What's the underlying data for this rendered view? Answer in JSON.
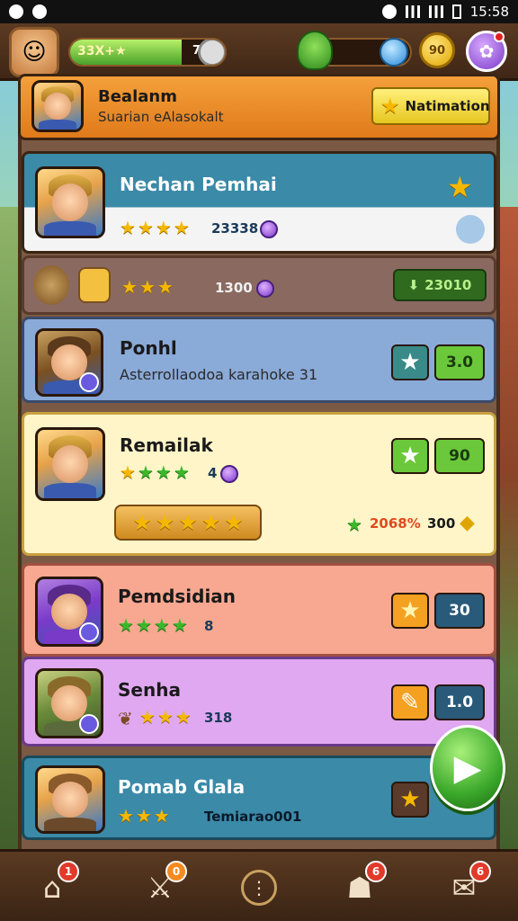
{
  "status_bar": {
    "time": "15:58"
  },
  "hud": {
    "xp_label": "33X+★",
    "xp_value": "70",
    "xp_progress": 0.72,
    "coins": "90"
  },
  "banner": {
    "name": "Bealanm",
    "subtitle": "Suarian eAlasokalt",
    "button_label": "Natimation"
  },
  "players": [
    {
      "name": "Nechan Pemhai",
      "stars": 4,
      "value": "23338"
    },
    {
      "name": "",
      "stars": 3,
      "value": "1300",
      "action_value": "23010"
    },
    {
      "name": "Ponhl",
      "subtitle": "Asterrollaodoa karahoke 31",
      "number": "3.0"
    },
    {
      "name": "Remailak",
      "stars": 4,
      "value": "4",
      "reward_stars": 5,
      "percent": "2068%",
      "reward": "300",
      "number": "90"
    },
    {
      "name": "Pemdsidian",
      "stars": 4,
      "value": "8",
      "number": "30"
    },
    {
      "name": "Senha",
      "stars": 3,
      "value": "318",
      "number": "1.0"
    },
    {
      "name": "Pomab Glala",
      "stars": 3,
      "value": "Temiarao001"
    }
  ],
  "nav": {
    "badges": [
      "1",
      "0",
      "",
      "6",
      "6"
    ]
  }
}
